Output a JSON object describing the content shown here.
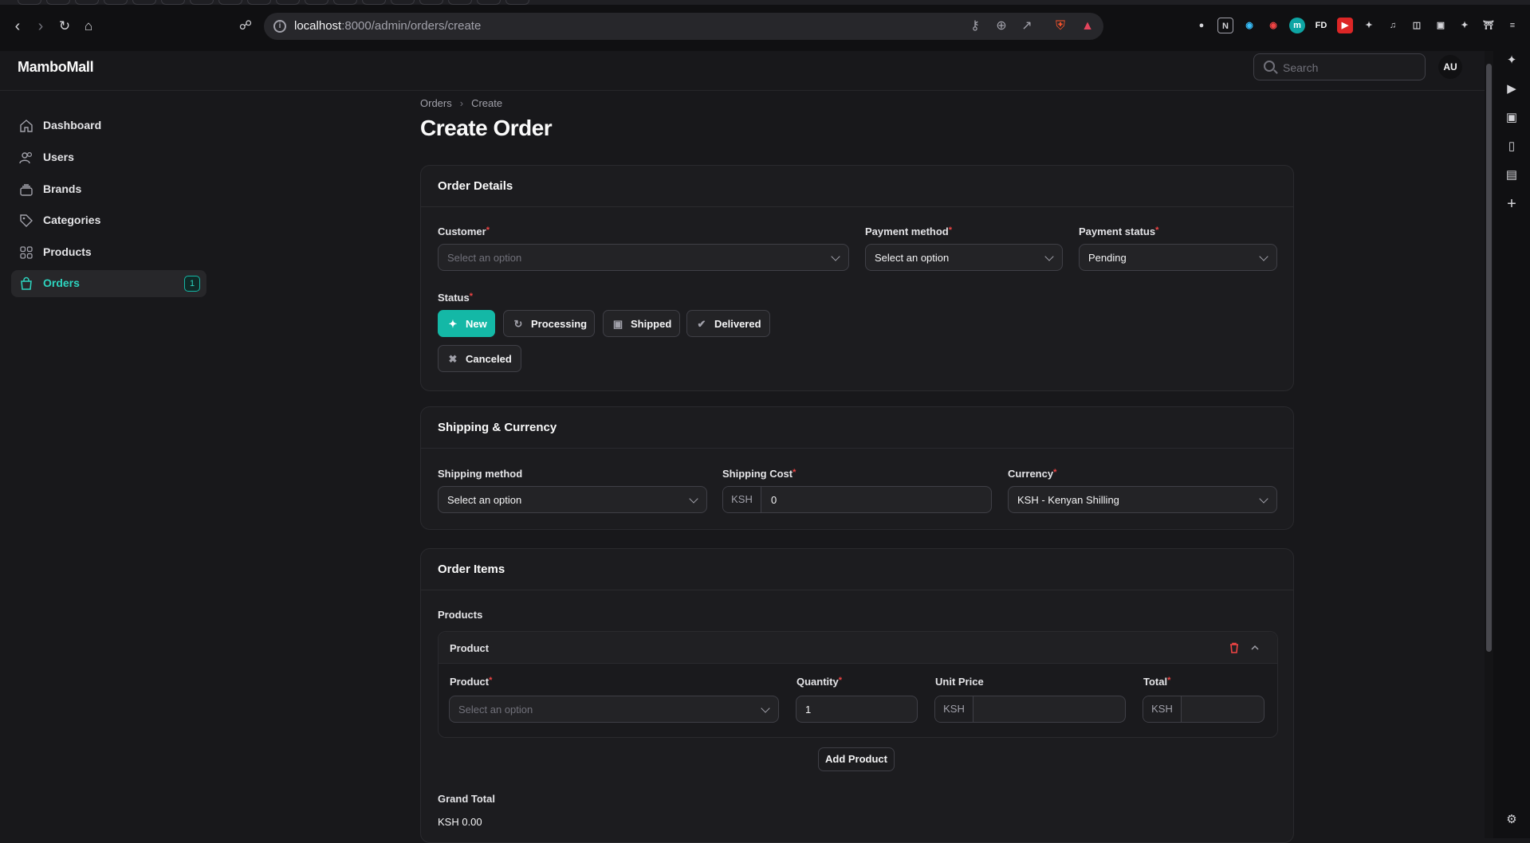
{
  "browser": {
    "url_host": "localhost",
    "url_rest": ":8000/admin/orders/create"
  },
  "app": {
    "brand": "MamboMall",
    "search_placeholder": "Search",
    "avatar_initials": "AU"
  },
  "sidebar": {
    "items": [
      {
        "label": "Dashboard",
        "icon": "home-icon"
      },
      {
        "label": "Users",
        "icon": "users-icon"
      },
      {
        "label": "Brands",
        "icon": "stack-icon"
      },
      {
        "label": "Categories",
        "icon": "tag-icon"
      },
      {
        "label": "Products",
        "icon": "grid-icon"
      },
      {
        "label": "Orders",
        "icon": "shopping-bag-icon",
        "badge": "1",
        "active": true
      }
    ]
  },
  "breadcrumb": {
    "parent": "Orders",
    "current": "Create"
  },
  "page_title": "Create Order",
  "order_details": {
    "title": "Order Details",
    "customer_label": "Customer",
    "customer_placeholder": "Select an option",
    "payment_method_label": "Payment method",
    "payment_method_value": "Select an option",
    "payment_status_label": "Payment status",
    "payment_status_value": "Pending",
    "status_label": "Status",
    "statuses": [
      "New",
      "Processing",
      "Shipped",
      "Delivered",
      "Canceled"
    ],
    "selected_status": "New"
  },
  "shipping": {
    "title": "Shipping & Currency",
    "method_label": "Shipping method",
    "method_value": "Select an option",
    "cost_label": "Shipping Cost",
    "cost_prefix": "KSH",
    "cost_value": "0",
    "currency_label": "Currency",
    "currency_value": "KSH - Kenyan Shilling"
  },
  "order_items": {
    "title": "Order Items",
    "products_label": "Products",
    "item_title": "Product",
    "product_label": "Product",
    "product_placeholder": "Select an option",
    "quantity_label": "Quantity",
    "quantity_value": "1",
    "unit_price_label": "Unit Price",
    "unit_price_prefix": "KSH",
    "total_label": "Total",
    "total_prefix": "KSH",
    "add_product_label": "Add Product",
    "grand_total_label": "Grand Total",
    "grand_total_value": "KSH 0.00"
  },
  "colors": {
    "accent": "#14b8a6",
    "required": "#ef4444",
    "background": "#18181b"
  }
}
